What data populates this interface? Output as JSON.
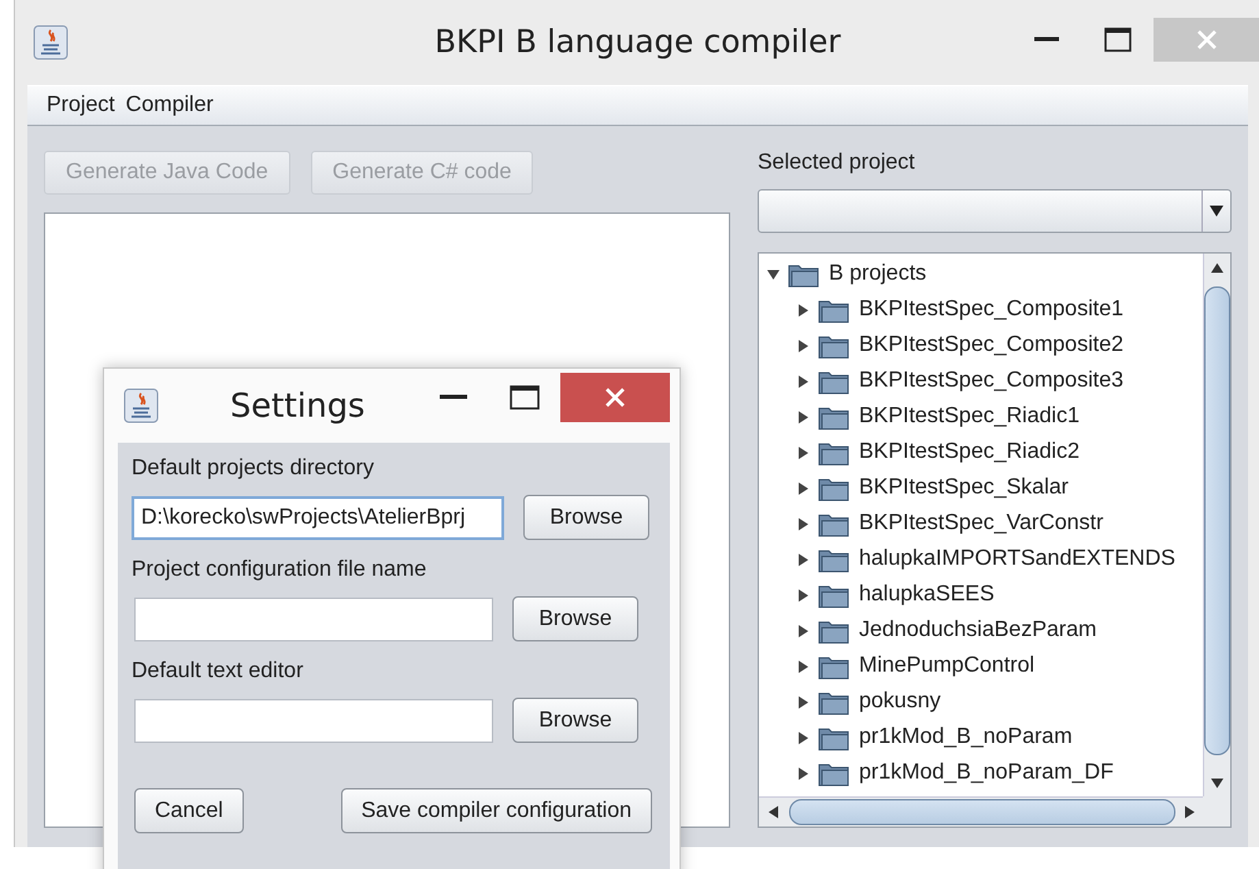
{
  "window": {
    "title": "BKPI B language compiler"
  },
  "menu": [
    {
      "label": "Project"
    },
    {
      "label": "Compiler"
    }
  ],
  "toolbar": [
    {
      "label": "Generate Java Code",
      "disabled": true
    },
    {
      "label": "Generate C# code",
      "disabled": true
    }
  ],
  "selected_project": {
    "label": "Selected project"
  },
  "tree": {
    "label": "B projects",
    "expanded": true,
    "children": [
      {
        "label": "BKPItestSpec_Composite1",
        "expanded": false
      },
      {
        "label": "BKPItestSpec_Composite2",
        "expanded": false
      },
      {
        "label": "BKPItestSpec_Composite3",
        "expanded": false
      },
      {
        "label": "BKPItestSpec_Riadic1",
        "expanded": false
      },
      {
        "label": "BKPItestSpec_Riadic2",
        "expanded": false
      },
      {
        "label": "BKPItestSpec_Skalar",
        "expanded": false
      },
      {
        "label": "BKPItestSpec_VarConstr",
        "expanded": false
      },
      {
        "label": "halupkaIMPORTSandEXTENDS",
        "expanded": false
      },
      {
        "label": "halupkaSEES",
        "expanded": false
      },
      {
        "label": "JednoduchsiaBezParam",
        "expanded": false
      },
      {
        "label": "MinePumpControl",
        "expanded": false
      },
      {
        "label": "pokusny",
        "expanded": false
      },
      {
        "label": "pr1kMod_B_noParam",
        "expanded": false
      },
      {
        "label": "pr1kMod_B_noParam_DF",
        "expanded": false
      }
    ]
  },
  "settings_dialog": {
    "title": "Settings",
    "fields": [
      {
        "label": "Default projects directory",
        "value": "D:\\korecko\\swProjects\\AtelierBprj",
        "focused": true,
        "button": "Browse"
      },
      {
        "label": "Project configuration file name",
        "focused": false,
        "button": "Browse"
      },
      {
        "label": "Default text editor",
        "focused": false,
        "button": "Browse"
      }
    ],
    "buttons": [
      {
        "label": "Cancel"
      },
      {
        "label": "Save compiler configuration"
      }
    ]
  }
}
